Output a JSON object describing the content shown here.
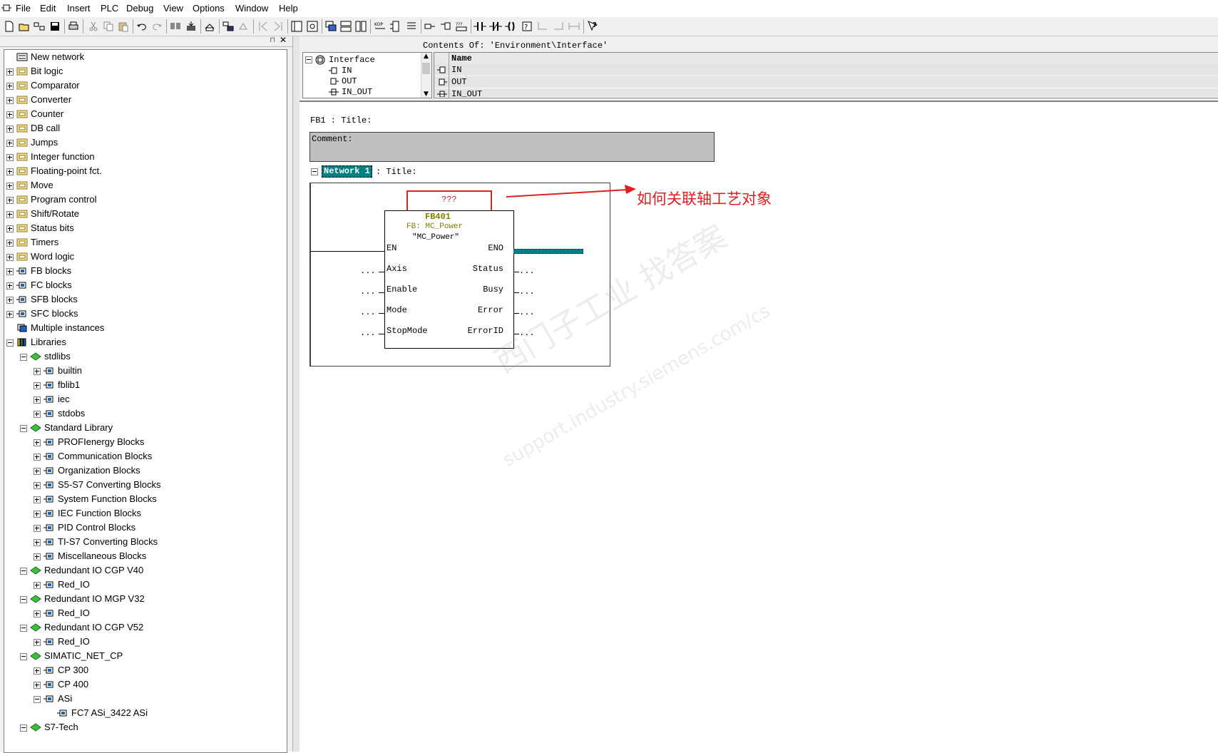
{
  "menu": [
    "File",
    "Edit",
    "Insert",
    "PLC",
    "Debug",
    "View",
    "Options",
    "Window",
    "Help"
  ],
  "tree": {
    "items": [
      {
        "label": "New network",
        "level": 0,
        "expander": "none",
        "icon": "new-network-icon"
      },
      {
        "label": "Bit logic",
        "level": 0,
        "expander": "plus",
        "icon": "bit-logic-icon"
      },
      {
        "label": "Comparator",
        "level": 0,
        "expander": "plus",
        "icon": "comparator-icon"
      },
      {
        "label": "Converter",
        "level": 0,
        "expander": "plus",
        "icon": "converter-icon"
      },
      {
        "label": "Counter",
        "level": 0,
        "expander": "plus",
        "icon": "counter-icon"
      },
      {
        "label": "DB call",
        "level": 0,
        "expander": "plus",
        "icon": "db-call-icon"
      },
      {
        "label": "Jumps",
        "level": 0,
        "expander": "plus",
        "icon": "jumps-icon"
      },
      {
        "label": "Integer function",
        "level": 0,
        "expander": "plus",
        "icon": "integer-function-icon"
      },
      {
        "label": "Floating-point fct.",
        "level": 0,
        "expander": "plus",
        "icon": "floating-point-icon"
      },
      {
        "label": "Move",
        "level": 0,
        "expander": "plus",
        "icon": "move-icon"
      },
      {
        "label": "Program control",
        "level": 0,
        "expander": "plus",
        "icon": "program-control-icon"
      },
      {
        "label": "Shift/Rotate",
        "level": 0,
        "expander": "plus",
        "icon": "shift-rotate-icon"
      },
      {
        "label": "Status bits",
        "level": 0,
        "expander": "plus",
        "icon": "status-bits-icon"
      },
      {
        "label": "Timers",
        "level": 0,
        "expander": "plus",
        "icon": "timers-icon"
      },
      {
        "label": "Word logic",
        "level": 0,
        "expander": "plus",
        "icon": "word-logic-icon"
      },
      {
        "label": "FB blocks",
        "level": 0,
        "expander": "plus",
        "icon": "block-icon"
      },
      {
        "label": "FC blocks",
        "level": 0,
        "expander": "plus",
        "icon": "block-icon"
      },
      {
        "label": "SFB blocks",
        "level": 0,
        "expander": "plus",
        "icon": "block-icon"
      },
      {
        "label": "SFC blocks",
        "level": 0,
        "expander": "plus",
        "icon": "block-icon"
      },
      {
        "label": "Multiple instances",
        "level": 0,
        "expander": "none",
        "icon": "multiple-instances-icon"
      },
      {
        "label": "Libraries",
        "level": 0,
        "expander": "minus",
        "icon": "libraries-icon"
      },
      {
        "label": "stdlibs",
        "level": 1,
        "expander": "minus",
        "icon": "library-book-icon"
      },
      {
        "label": "builtin",
        "level": 2,
        "expander": "plus",
        "icon": "block-icon"
      },
      {
        "label": "fblib1",
        "level": 2,
        "expander": "plus",
        "icon": "block-icon"
      },
      {
        "label": "iec",
        "level": 2,
        "expander": "plus",
        "icon": "block-icon"
      },
      {
        "label": "stdobs",
        "level": 2,
        "expander": "plus",
        "icon": "block-icon"
      },
      {
        "label": "Standard Library",
        "level": 1,
        "expander": "minus",
        "icon": "library-book-icon"
      },
      {
        "label": "PROFIenergy Blocks",
        "level": 2,
        "expander": "plus",
        "icon": "block-icon"
      },
      {
        "label": "Communication Blocks",
        "level": 2,
        "expander": "plus",
        "icon": "block-icon"
      },
      {
        "label": "Organization Blocks",
        "level": 2,
        "expander": "plus",
        "icon": "block-icon"
      },
      {
        "label": "S5-S7 Converting Blocks",
        "level": 2,
        "expander": "plus",
        "icon": "block-icon"
      },
      {
        "label": "System Function Blocks",
        "level": 2,
        "expander": "plus",
        "icon": "block-icon"
      },
      {
        "label": "IEC Function Blocks",
        "level": 2,
        "expander": "plus",
        "icon": "block-icon"
      },
      {
        "label": "PID Control Blocks",
        "level": 2,
        "expander": "plus",
        "icon": "block-icon"
      },
      {
        "label": "TI-S7 Converting Blocks",
        "level": 2,
        "expander": "plus",
        "icon": "block-icon"
      },
      {
        "label": "Miscellaneous Blocks",
        "level": 2,
        "expander": "plus",
        "icon": "block-icon"
      },
      {
        "label": "Redundant IO CGP V40",
        "level": 1,
        "expander": "minus",
        "icon": "library-book-icon"
      },
      {
        "label": "Red_IO",
        "level": 2,
        "expander": "plus",
        "icon": "block-icon"
      },
      {
        "label": "Redundant IO MGP V32",
        "level": 1,
        "expander": "minus",
        "icon": "library-book-icon"
      },
      {
        "label": "Red_IO",
        "level": 2,
        "expander": "plus",
        "icon": "block-icon"
      },
      {
        "label": "Redundant IO CGP V52",
        "level": 1,
        "expander": "minus",
        "icon": "library-book-icon"
      },
      {
        "label": "Red_IO",
        "level": 2,
        "expander": "plus",
        "icon": "block-icon"
      },
      {
        "label": "SIMATIC_NET_CP",
        "level": 1,
        "expander": "minus",
        "icon": "library-book-icon"
      },
      {
        "label": "CP 300",
        "level": 2,
        "expander": "plus",
        "icon": "block-icon"
      },
      {
        "label": "CP 400",
        "level": 2,
        "expander": "plus",
        "icon": "block-icon"
      },
      {
        "label": "ASi",
        "level": 2,
        "expander": "minus",
        "icon": "block-icon"
      },
      {
        "label": "FC7     ASi_3422     ASi",
        "level": 3,
        "expander": "none",
        "icon": "fc-block-icon"
      },
      {
        "label": "S7-Tech",
        "level": 1,
        "expander": "minus",
        "icon": "library-book-icon"
      }
    ]
  },
  "interface": {
    "contents_label": "Contents Of:  'Environment\\Interface'",
    "tree": [
      {
        "label": "Interface",
        "root": true
      },
      {
        "label": "IN",
        "root": false
      },
      {
        "label": "OUT",
        "root": false
      },
      {
        "label": "IN_OUT",
        "root": false
      }
    ],
    "column_header": "Name",
    "rows": [
      "IN",
      "OUT",
      "IN_OUT"
    ]
  },
  "editor": {
    "block_title": "FB1 : Title:",
    "comment_label": "Comment:",
    "network_label": "Network 1",
    "network_title": ": Title:",
    "instance_db": "???",
    "fb_number": "FB401",
    "fb_type": "FB: MC_Power",
    "fb_symbol": "\"MC_Power\"",
    "inputs": [
      {
        "pin": "EN",
        "param": ""
      },
      {
        "pin": "Axis",
        "param": "..."
      },
      {
        "pin": "Enable",
        "param": "..."
      },
      {
        "pin": "Mode",
        "param": "..."
      },
      {
        "pin": "StopMode",
        "param": "..."
      }
    ],
    "outputs": [
      {
        "pin": "ENO",
        "param": ""
      },
      {
        "pin": "Status",
        "param": "..."
      },
      {
        "pin": "Busy",
        "param": "..."
      },
      {
        "pin": "Error",
        "param": "..."
      },
      {
        "pin": "ErrorID",
        "param": "..."
      }
    ]
  },
  "annotation": {
    "text": "如何关联轴工艺对象",
    "color": "#e02020"
  },
  "watermark": {
    "line1": "西门子工业   找答案",
    "line2": "support.industry.siemens.com/cs"
  },
  "colors": {
    "network_highlight": "#008080",
    "comment_bg": "#c0c0c0",
    "fb_name_color": "#808000"
  }
}
